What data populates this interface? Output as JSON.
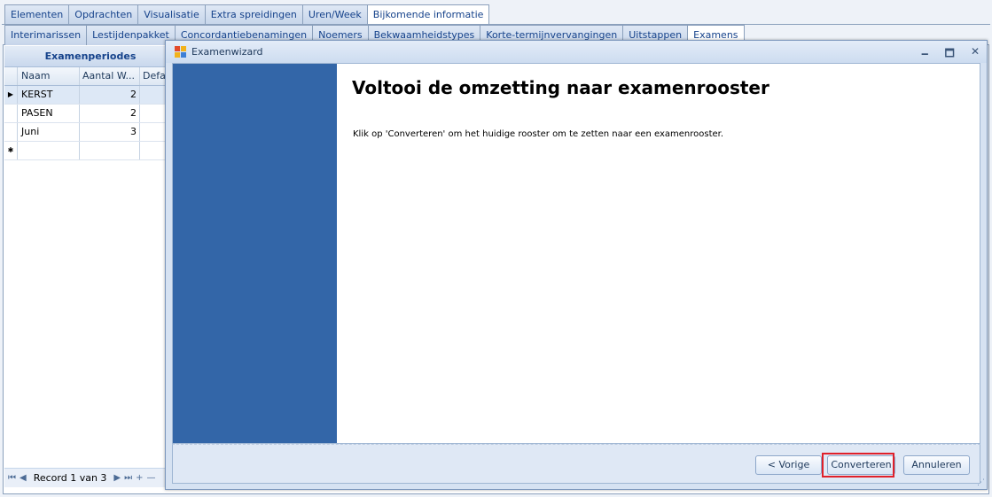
{
  "main_tabs": [
    "Elementen",
    "Opdrachten",
    "Visualisatie",
    "Extra spreidingen",
    "Uren/Week",
    "Bijkomende informatie"
  ],
  "sub_tabs": [
    "Interimarissen",
    "Lestijdenpakket",
    "Concordantiebenamingen",
    "Noemers",
    "Bekwaamheidstypes",
    "Korte-termijnvervangingen",
    "Uitstappen",
    "Examens"
  ],
  "grid": {
    "title": "Examenperiodes",
    "columns": [
      "Naam",
      "Aantal W...",
      "Defau"
    ],
    "rows": [
      {
        "indicator": "▶",
        "name": "KERST",
        "count": "2"
      },
      {
        "indicator": "",
        "name": "PASEN",
        "count": "2"
      },
      {
        "indicator": "",
        "name": "Juni",
        "count": "3"
      }
    ],
    "new_row_indicator": "✱",
    "navigator": {
      "first": "⏮",
      "prev": "◀",
      "record_text": "Record 1 van 3",
      "next": "▶",
      "last": "⏭",
      "add": "+",
      "remove": "—"
    }
  },
  "wizard": {
    "window_title": "Examenwizard",
    "controls": {
      "minimize": "🗕",
      "maximize": "🗖",
      "close": "✕"
    },
    "heading": "Voltooi de omzetting naar examenrooster",
    "description": "Klik op 'Converteren' om het huidige rooster om te zetten naar een examenrooster.",
    "buttons": {
      "prev": "< Vorige",
      "convert": "Converteren",
      "cancel": "Annuleren"
    },
    "sidebar_color": "#3366a8"
  }
}
